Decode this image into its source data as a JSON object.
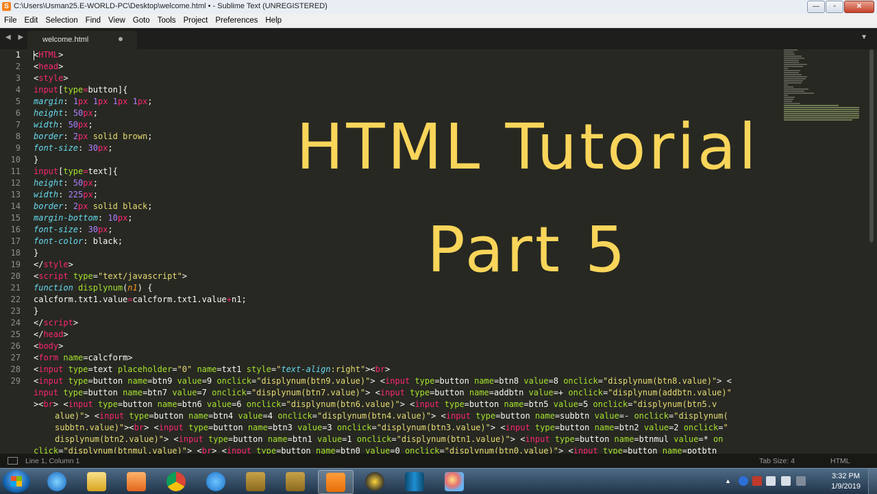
{
  "window": {
    "title": "C:\\Users\\Usman25.E-WORLD-PC\\Desktop\\welcome.html • - Sublime Text (UNREGISTERED)",
    "app_icon": "S",
    "buttons": {
      "minimize": "—",
      "maximize": "▫",
      "close": "✕"
    }
  },
  "menu": [
    "File",
    "Edit",
    "Selection",
    "Find",
    "View",
    "Goto",
    "Tools",
    "Project",
    "Preferences",
    "Help"
  ],
  "tabs": {
    "arrows": "◀ ▶",
    "active": "welcome.html",
    "dropdown": "▼"
  },
  "overlay": {
    "line1": "HTML Tutorial",
    "line2": "Part 5"
  },
  "statusbar": {
    "position": "Line 1, Column 1",
    "tab_size": "Tab Size: 4",
    "syntax": "HTML"
  },
  "taskbar": {
    "apps": [
      "start-button",
      "internet-explorer",
      "file-explorer",
      "media-player",
      "chrome",
      "video-app",
      "dosbox-1",
      "dosbox-2",
      "sublime-text",
      "audio-app",
      "terminal-app",
      "paint-app"
    ],
    "active_app": "sublime-text"
  },
  "clock": {
    "time": "3:32 PM",
    "date": "1/9/2019"
  },
  "colors": {
    "bg": "#272822",
    "tag": "#f92672",
    "attr": "#a6e22e",
    "string": "#e6db74",
    "number": "#ae81ff",
    "property": "#66d9ef",
    "overlay": "#f9d55a"
  },
  "code": {
    "line_numbers": [
      "1",
      "2",
      "3",
      "4",
      "5",
      "6",
      "7",
      "8",
      "9",
      "10",
      "11",
      "12",
      "13",
      "14",
      "15",
      "16",
      "17",
      "18",
      "19",
      "20",
      "21",
      "22",
      "23",
      "24",
      "25",
      "26",
      "27",
      "28",
      "29"
    ],
    "lines": [
      {
        "ts": [
          {
            "c": "t",
            "x": "HTML"
          }
        ],
        "pre": "<",
        "post": ">"
      }
    ]
  }
}
